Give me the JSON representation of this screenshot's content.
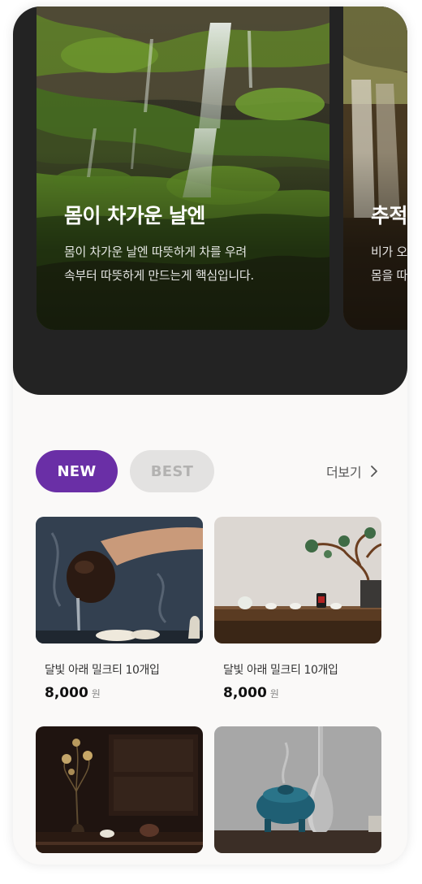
{
  "hero": {
    "slides": [
      {
        "title": "몸이 차가운 날엔",
        "desc_line1": "몸이 차가운 날엔 따뜻하게 차를 우려",
        "desc_line2": "속부터 따뜻하게 만드는게 핵심입니다.",
        "image": "waterfall-moss-photo"
      },
      {
        "title": "추적",
        "desc_line1": "비가 오",
        "desc_line2": "몸을 따",
        "image": "waterfall-photo"
      }
    ]
  },
  "tabs": {
    "new_label": "NEW",
    "best_label": "BEST",
    "selected": "NEW"
  },
  "more_label": "더보기",
  "products": [
    {
      "name": "달빛 아래 밀크티 10개입",
      "price": "8,000",
      "unit": "원",
      "image": "pouring-tea-photo"
    },
    {
      "name": "달빛 아래 밀크티 10개입",
      "price": "8,000",
      "unit": "원",
      "image": "tea-table-bonsai-photo"
    },
    {
      "image": "dark-tea-room-photo"
    },
    {
      "image": "incense-burner-vase-photo"
    }
  ],
  "colors": {
    "accent": "#6a2fa6",
    "hero_bg": "#232323",
    "page_bg": "#faf9f8"
  },
  "icons": {
    "more": "chevron-right-icon"
  }
}
